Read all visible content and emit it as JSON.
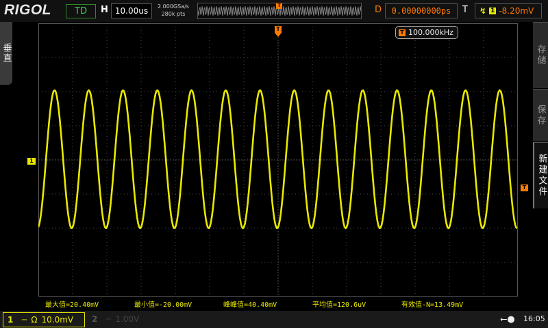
{
  "header": {
    "logo": "RIGOL",
    "run_mode": "TD",
    "timebase_label": "H",
    "timebase_value": "10.00us",
    "sample_rate": "2.000GSa/s",
    "memory_depth": "280k pts",
    "delay_label": "D",
    "delay_value": "0.00000000ps",
    "trigger_label": "T",
    "trigger_source": "1",
    "trigger_level": "-8.20mV"
  },
  "markers": {
    "trigger_tag": "T",
    "ch1_tag": "1"
  },
  "frequency_badge": "100.000kHz",
  "left_menu": {
    "vertical_label": "垂直"
  },
  "right_menu": [
    {
      "label": "存储"
    },
    {
      "label": "保存"
    },
    {
      "label": "新建文件"
    }
  ],
  "measurements": [
    "最大值=20.40mV",
    "最小值=-20.00mV",
    "峰峰值=40.40mV",
    "平均值=120.6uV",
    "有效值-N=13.49mV"
  ],
  "channels": {
    "ch1": {
      "number": "1",
      "scale": "10.0mV"
    },
    "ch2": {
      "number": "2",
      "scale": "1.00V"
    }
  },
  "status": {
    "time": "16:05"
  },
  "colors": {
    "ch1": "#e8e800",
    "trigger": "#ff7a00",
    "grid": "#444444"
  },
  "chart_data": {
    "type": "line",
    "waveform": "sine",
    "cycles_on_screen": 14,
    "frequency": "100.000kHz",
    "peak": 20.4,
    "trough": -20.0
  }
}
